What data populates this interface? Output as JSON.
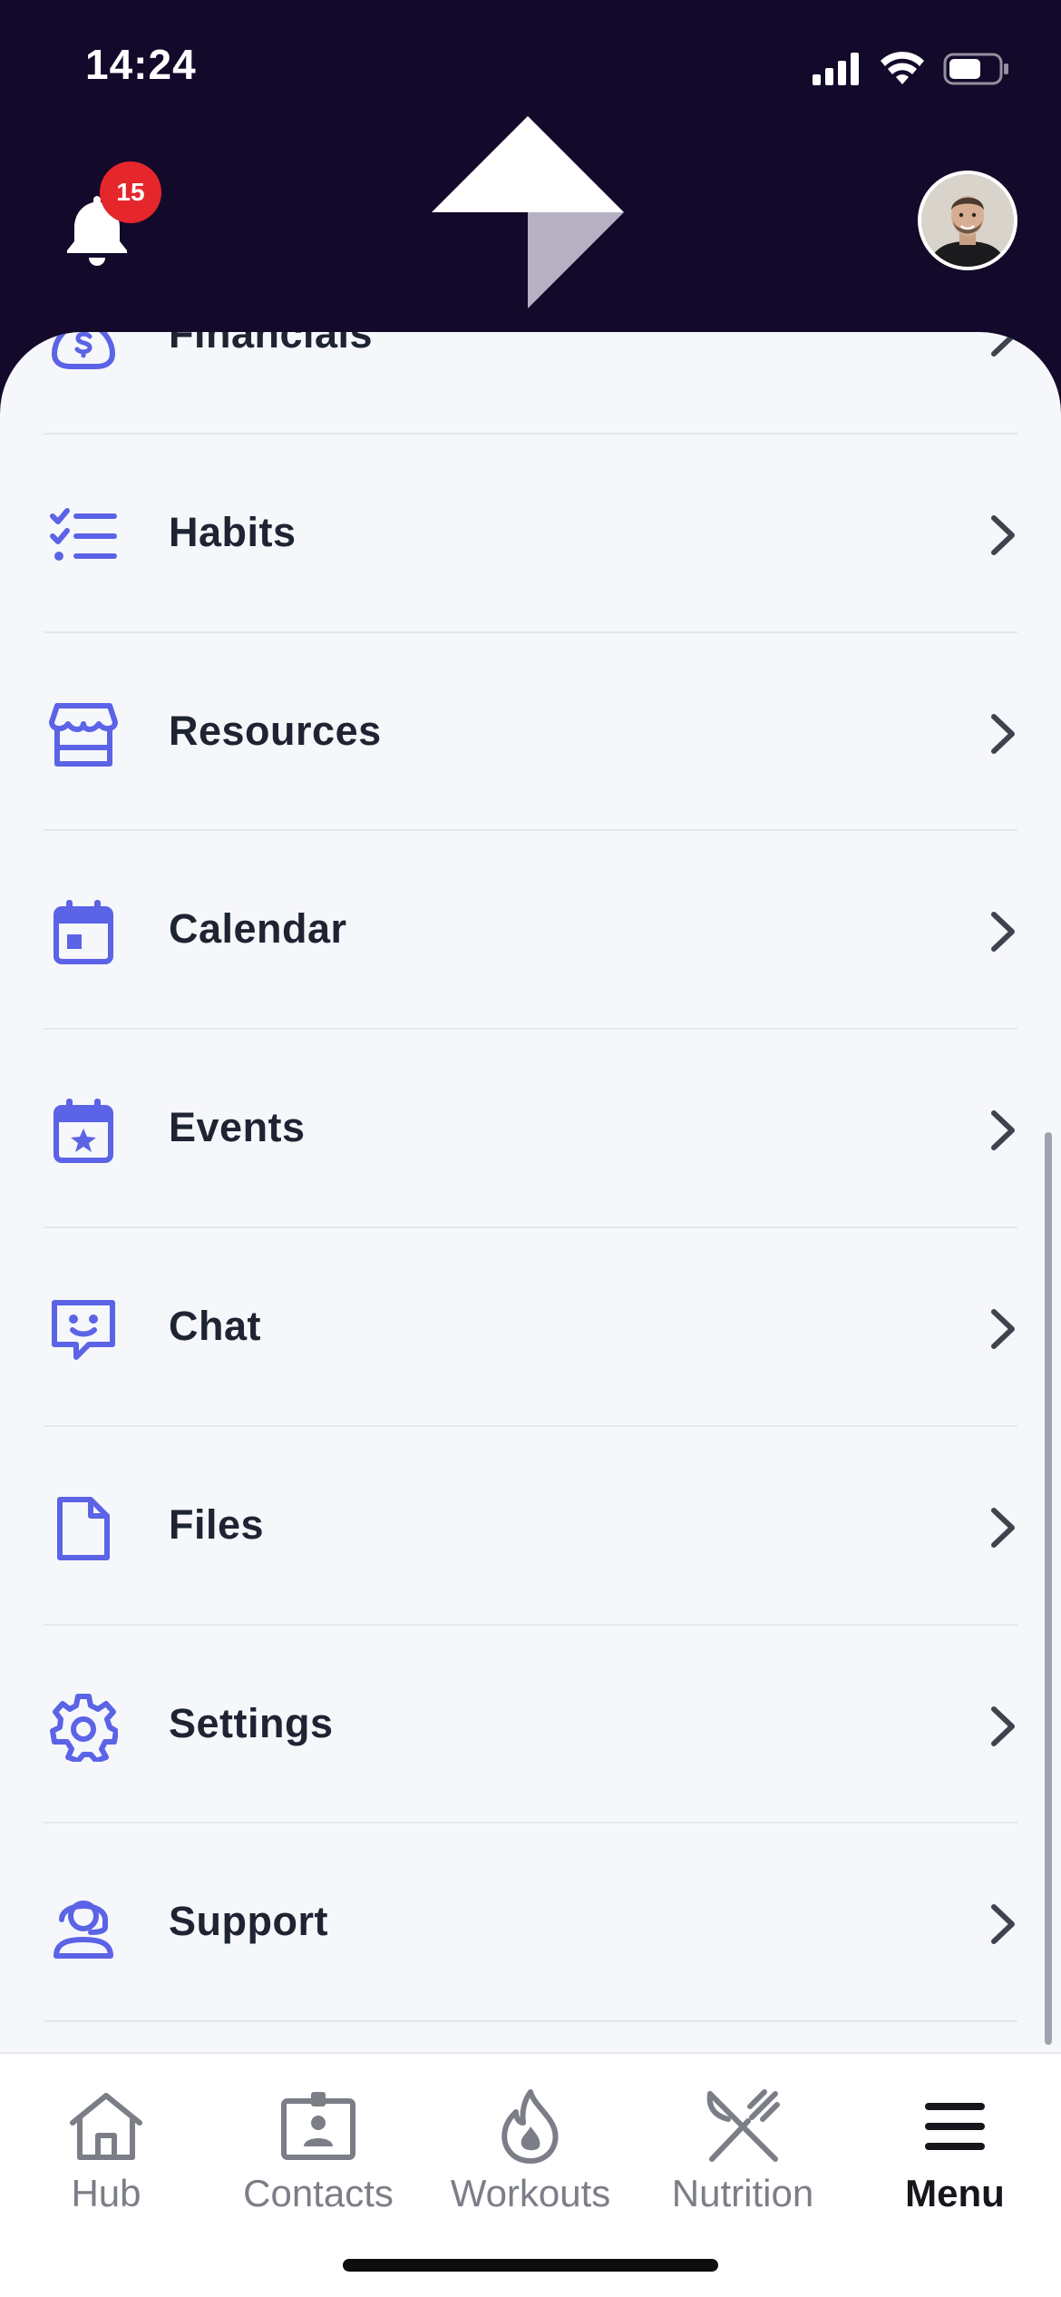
{
  "status_bar": {
    "time": "14:24"
  },
  "header": {
    "notification_count": "15"
  },
  "menu": {
    "items": [
      {
        "label": "Financials",
        "icon": "money-bag-icon"
      },
      {
        "label": "Habits",
        "icon": "checklist-icon"
      },
      {
        "label": "Resources",
        "icon": "store-icon"
      },
      {
        "label": "Calendar",
        "icon": "calendar-icon"
      },
      {
        "label": "Events",
        "icon": "calendar-star-icon"
      },
      {
        "label": "Chat",
        "icon": "chat-smile-icon"
      },
      {
        "label": "Files",
        "icon": "file-icon"
      },
      {
        "label": "Settings",
        "icon": "gear-icon"
      },
      {
        "label": "Support",
        "icon": "headset-icon"
      }
    ]
  },
  "tabbar": {
    "tabs": [
      {
        "label": "Hub",
        "icon": "home-icon"
      },
      {
        "label": "Contacts",
        "icon": "contact-card-icon"
      },
      {
        "label": "Workouts",
        "icon": "flame-icon"
      },
      {
        "label": "Nutrition",
        "icon": "fork-knife-icon"
      },
      {
        "label": "Menu",
        "icon": "hamburger-icon",
        "active": true
      }
    ]
  },
  "colors": {
    "header_bg": "#13092a",
    "accent_icon": "#5b63e6",
    "badge": "#e5262b",
    "sheet_bg": "#f6f7fb"
  }
}
